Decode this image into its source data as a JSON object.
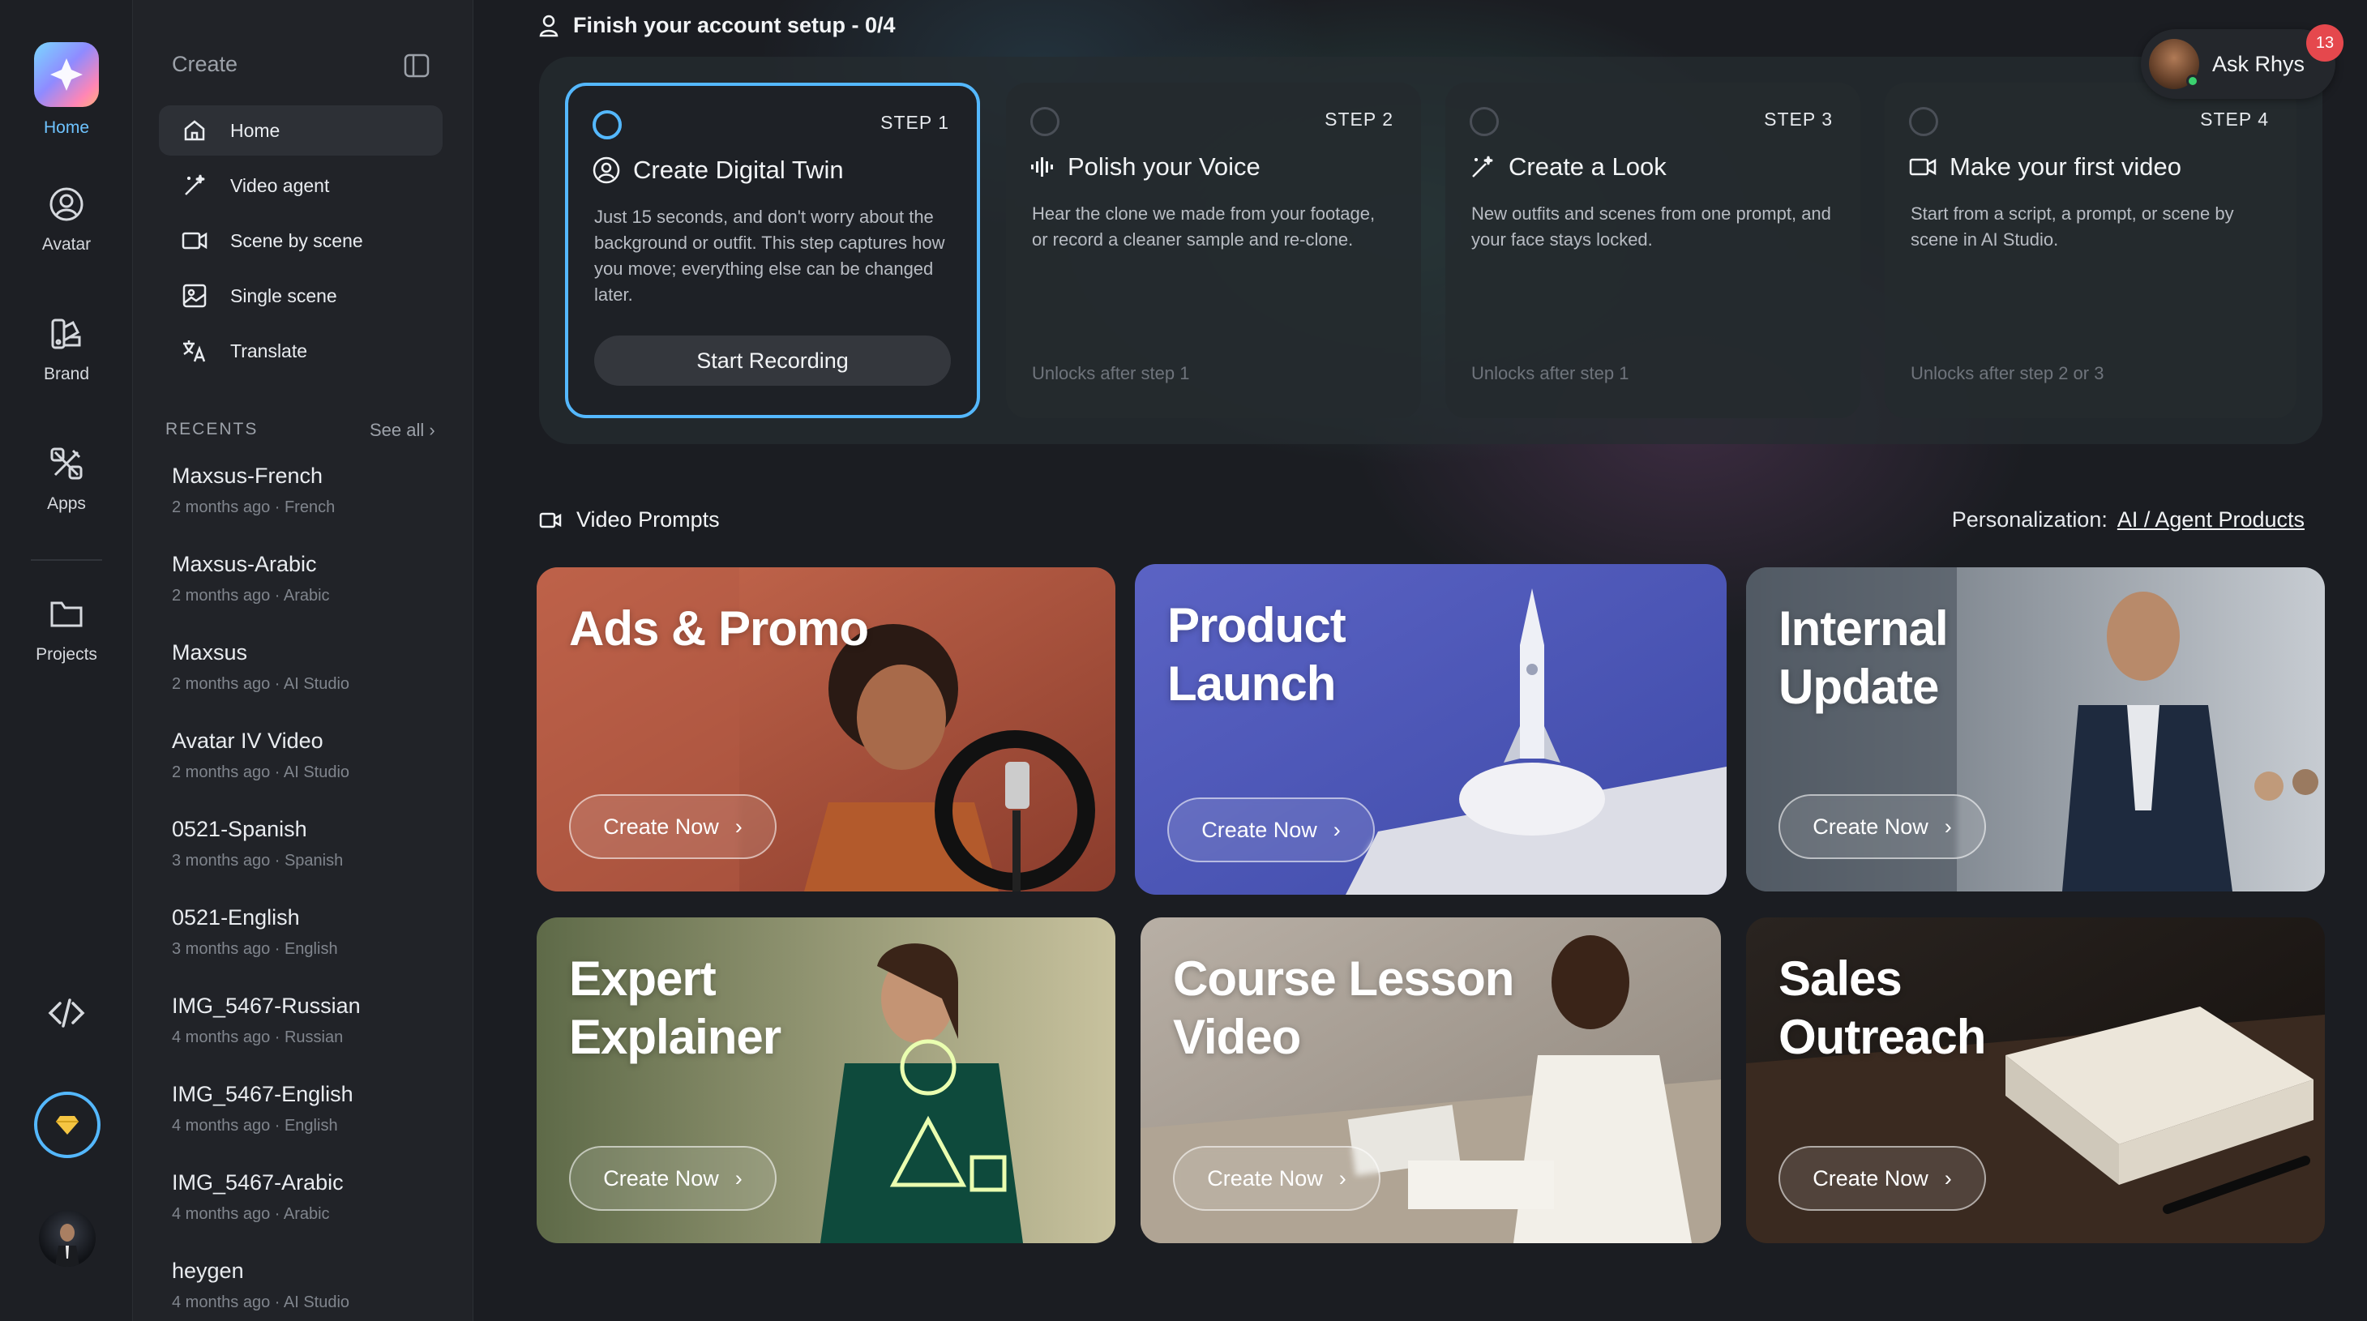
{
  "rail": {
    "items": [
      {
        "label": "Home",
        "icon": "home-logo-icon"
      },
      {
        "label": "Avatar",
        "icon": "avatar-icon"
      },
      {
        "label": "Brand",
        "icon": "brand-icon"
      },
      {
        "label": "Apps",
        "icon": "apps-icon"
      },
      {
        "label": "Projects",
        "icon": "folder-icon"
      }
    ],
    "accent": "#54b8ff"
  },
  "sidebar": {
    "title": "Create",
    "menu": [
      {
        "label": "Home",
        "icon": "home-icon"
      },
      {
        "label": "Video agent",
        "icon": "magic-wand-icon"
      },
      {
        "label": "Scene by scene",
        "icon": "video-camera-icon"
      },
      {
        "label": "Single scene",
        "icon": "image-icon"
      },
      {
        "label": "Translate",
        "icon": "translate-icon"
      }
    ],
    "recents_label": "RECENTS",
    "see_all": "See all ›",
    "recents": [
      {
        "title": "Maxsus-French",
        "sub": "2 months ago · French"
      },
      {
        "title": "Maxsus-Arabic",
        "sub": "2 months ago · Arabic"
      },
      {
        "title": "Maxsus",
        "sub": "2 months ago · AI Studio"
      },
      {
        "title": "Avatar IV Video",
        "sub": "2 months ago · AI Studio"
      },
      {
        "title": "0521-Spanish",
        "sub": "3 months ago · Spanish"
      },
      {
        "title": "0521-English",
        "sub": "3 months ago · English"
      },
      {
        "title": "IMG_5467-Russian",
        "sub": "4 months ago · Russian"
      },
      {
        "title": "IMG_5467-English",
        "sub": "4 months ago · English"
      },
      {
        "title": "IMG_5467-Arabic",
        "sub": "4 months ago · Arabic"
      },
      {
        "title": "heygen",
        "sub": "4 months ago · AI Studio"
      }
    ]
  },
  "setup": {
    "title": "Finish your account setup - 0/4",
    "steps": [
      {
        "num": "STEP 1",
        "title": "Create Digital Twin",
        "desc": "Just 15 seconds, and don't worry about the background or outfit. This step captures how you move; everything else can be changed later.",
        "button": "Start Recording",
        "lock": ""
      },
      {
        "num": "STEP 2",
        "title": "Polish your Voice",
        "desc": "Hear the clone we made from your footage, or record a cleaner sample and re-clone.",
        "lock": "Unlocks after step 1"
      },
      {
        "num": "STEP 3",
        "title": "Create a Look",
        "desc": "New outfits and scenes from one prompt, and your face stays locked.",
        "lock": "Unlocks after step 1"
      },
      {
        "num": "STEP 4",
        "title": "Make your first video",
        "desc": "Start from a script, a prompt, or scene by scene in AI Studio.",
        "lock": "Unlocks after step 2 or 3"
      }
    ]
  },
  "assistant": {
    "label": "Ask Rhys",
    "badge": "13"
  },
  "prompts": {
    "title": "Video Prompts",
    "personalization_label": "Personalization:",
    "personalization_value": "AI / Agent Products",
    "cards": [
      {
        "title_line1": "Ads & Promo",
        "title_line2": "",
        "button": "Create Now"
      },
      {
        "title_line1": "Product",
        "title_line2": "Launch",
        "button": "Create Now"
      },
      {
        "title_line1": "Internal",
        "title_line2": "Update",
        "button": "Create Now"
      },
      {
        "title_line1": "Expert",
        "title_line2": "Explainer",
        "button": "Create Now"
      },
      {
        "title_line1": "Course Lesson",
        "title_line2": "Video",
        "button": "Create Now"
      },
      {
        "title_line1": "Sales",
        "title_line2": "Outreach",
        "button": "Create Now"
      }
    ]
  }
}
